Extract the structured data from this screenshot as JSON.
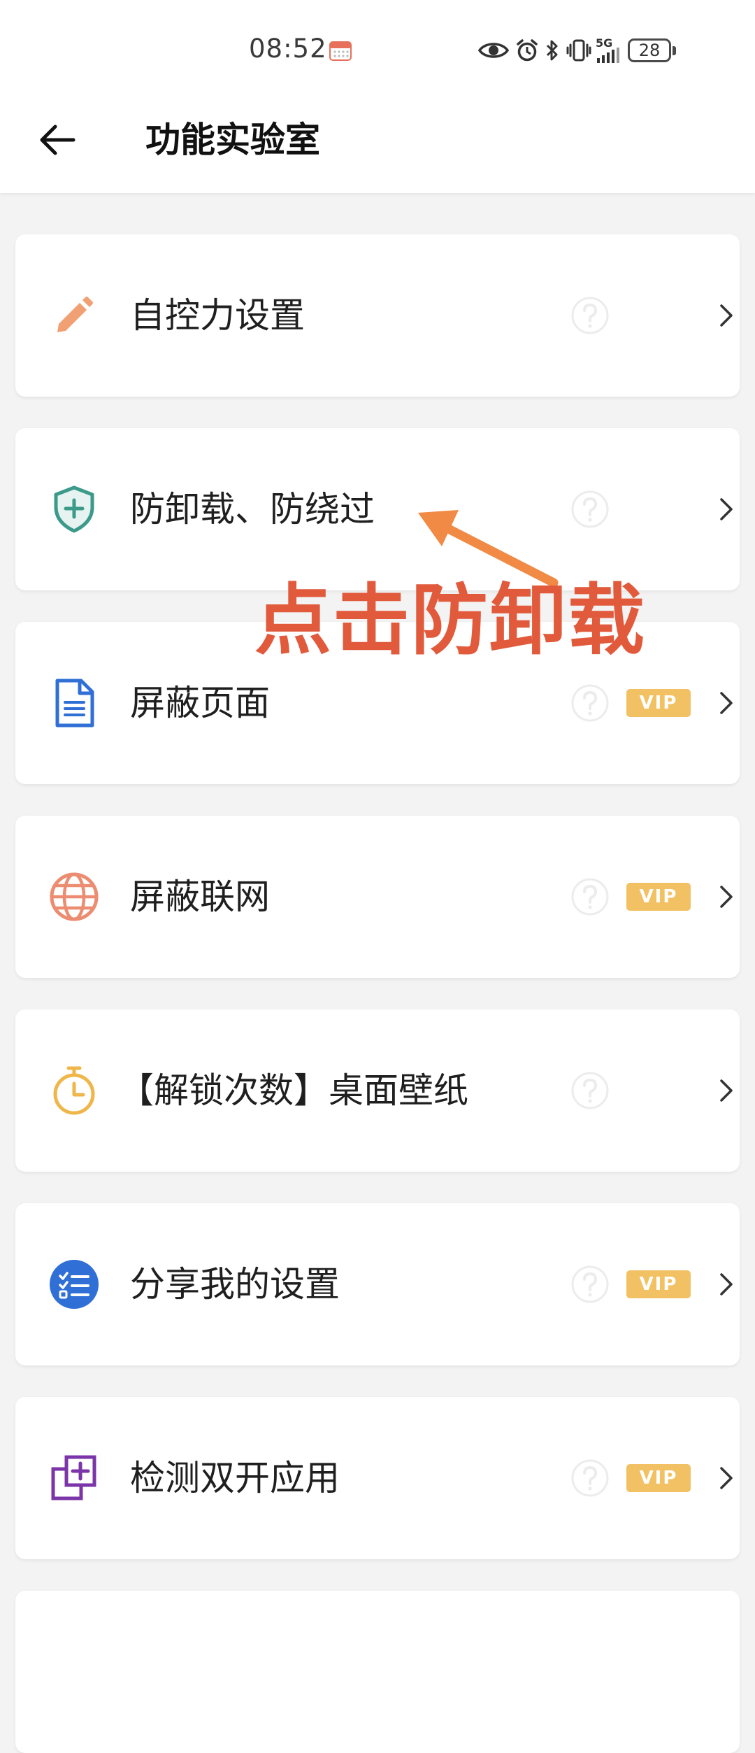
{
  "status_bar": {
    "time": "08:52",
    "network": "5G",
    "battery": "28"
  },
  "header": {
    "title": "功能实验室"
  },
  "items": [
    {
      "label": "自控力设置",
      "icon": "pencil-icon",
      "vip": false
    },
    {
      "label": "防卸载、防绕过",
      "icon": "shield-plus-icon",
      "vip": false
    },
    {
      "label": "屏蔽页面",
      "icon": "document-icon",
      "vip": true
    },
    {
      "label": "屏蔽联网",
      "icon": "globe-icon",
      "vip": true
    },
    {
      "label": "【解锁次数】桌面壁纸",
      "icon": "stopwatch-icon",
      "vip": false
    },
    {
      "label": "分享我的设置",
      "icon": "checklist-icon",
      "vip": true
    },
    {
      "label": "检测双开应用",
      "icon": "dual-window-icon",
      "vip": true
    }
  ],
  "vip_label": "VIP",
  "annotation": {
    "text": "点击防卸载",
    "color": "#e15a3c"
  },
  "colors": {
    "background": "#f3f3f3",
    "card": "#ffffff",
    "vip_badge": "#f2c163",
    "pencil": "#f0a072",
    "shield": "#3b9a8a",
    "document": "#2f6fd6",
    "globe": "#ec8c70",
    "stopwatch": "#efb64a",
    "checklist": "#2f6fd6",
    "dual_window": "#7b35a8"
  }
}
